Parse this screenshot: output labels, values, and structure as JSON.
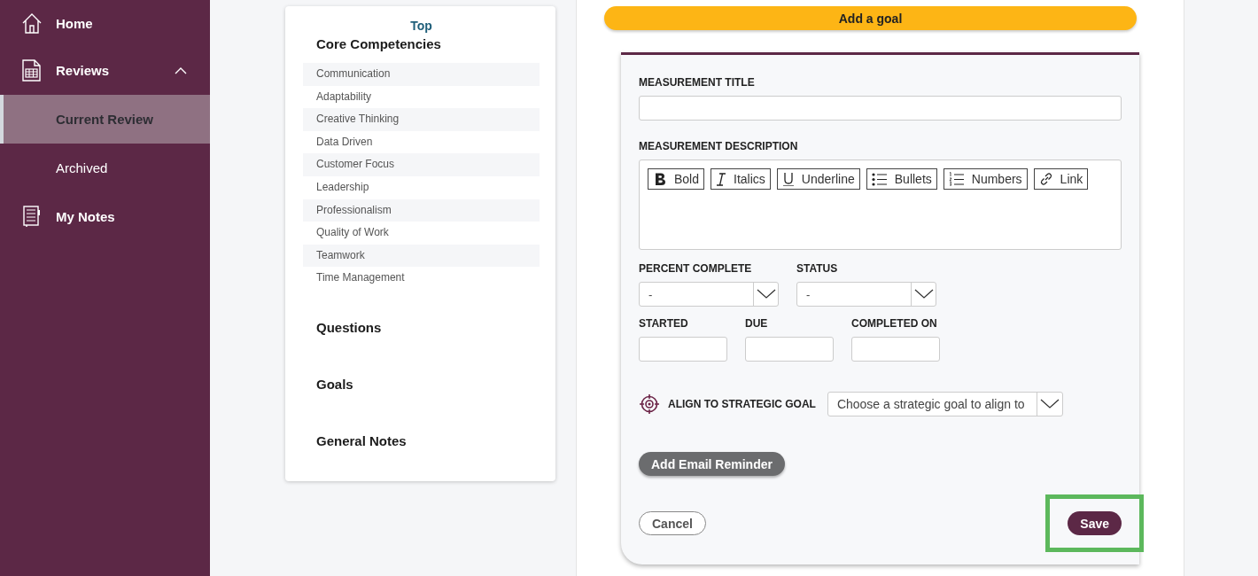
{
  "sidebar": {
    "items": [
      {
        "label": "Home",
        "kind": "home",
        "selected": false
      },
      {
        "label": "Reviews",
        "kind": "reviews",
        "selected": false,
        "expanded": true,
        "children": [
          {
            "label": "Current Review",
            "selected": true
          },
          {
            "label": "Archived",
            "selected": false
          }
        ]
      },
      {
        "label": "My Notes",
        "kind": "notes",
        "selected": false
      }
    ]
  },
  "outline": {
    "top_link": "Top",
    "sections": [
      {
        "title": "Core Competencies",
        "items": [
          "Communication",
          "Adaptability",
          "Creative Thinking",
          "Data Driven",
          "Customer Focus",
          "Leadership",
          "Professionalism",
          "Quality of Work",
          "Teamwork",
          "Time Management"
        ]
      },
      {
        "title": "Questions"
      },
      {
        "title": "Goals"
      },
      {
        "title": "General Notes"
      }
    ]
  },
  "add_goal_button": "Add a goal",
  "form": {
    "measurement_title": {
      "label": "MEASUREMENT TITLE"
    },
    "measurement_description": {
      "label": "MEASUREMENT DESCRIPTION",
      "toolbar": [
        {
          "kind": "bold",
          "label": "Bold"
        },
        {
          "kind": "italic",
          "label": "Italics"
        },
        {
          "kind": "underline",
          "label": "Underline"
        },
        {
          "kind": "bullets",
          "label": "Bullets"
        },
        {
          "kind": "numbers",
          "label": "Numbers"
        },
        {
          "kind": "link",
          "label": "Link"
        }
      ]
    },
    "selects": [
      {
        "label": "PERCENT COMPLETE",
        "value": "-"
      },
      {
        "label": "STATUS",
        "value": "-"
      }
    ],
    "dates": [
      {
        "label": "STARTED"
      },
      {
        "label": "DUE"
      },
      {
        "label": "COMPLETED ON"
      }
    ],
    "strategic_goal": {
      "label": "ALIGN TO STRATEGIC GOAL",
      "value": "Choose a strategic goal to align to"
    },
    "email_reminder_button": "Add Email Reminder",
    "cancel_button": "Cancel",
    "save_button": {
      "label": "Save",
      "highlighted": true
    }
  }
}
